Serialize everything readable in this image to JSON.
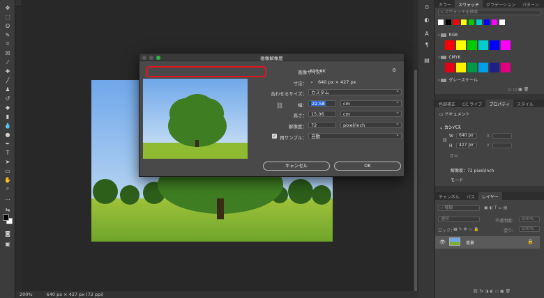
{
  "statusbar": {
    "zoom": "200%",
    "doc_info": "640 px × 427 px (72 ppi)"
  },
  "dialog": {
    "title": "画像解像度",
    "image_size_label": "画像サイズ：",
    "image_size_value": "800.6K",
    "dimensions_label": "寸法：",
    "dimensions_value": "640 px × 427 px",
    "fit_to_label": "合わせるサイズ：",
    "fit_to_value": "カスタム",
    "width_label": "幅：",
    "width_value": "22.58",
    "width_unit": "cm",
    "height_label": "高さ：",
    "height_value": "15.06",
    "height_unit": "cm",
    "resolution_label": "解像度：",
    "resolution_value": "72",
    "resolution_unit": "pixel/inch",
    "resample_label": "再サンプル：",
    "resample_value": "自動",
    "cancel_label": "キャンセル",
    "ok_label": "OK",
    "accent_highlight": "#e2151f"
  },
  "swatches_panel": {
    "tabs": [
      "カラー",
      "スウォッチ",
      "グラデーション",
      "パターン"
    ],
    "search_placeholder": "スウォッチを検索",
    "groups": [
      {
        "name": "RGB",
        "colors": [
          "#ff0000",
          "#ffff00",
          "#00cc00",
          "#00cccc",
          "#0000ff",
          "#ff00ff"
        ]
      },
      {
        "name": "CMYK",
        "colors": [
          "#e60012",
          "#fff100",
          "#009944",
          "#00a0e9",
          "#1d2088",
          "#e4007f"
        ]
      },
      {
        "name": "グレースケール",
        "colors": []
      }
    ],
    "top_colors": [
      "#ffffff",
      "#000000",
      "#ff0000",
      "#ffff00",
      "#00cc00",
      "#00cccc",
      "#0000ff",
      "#ff00ff",
      "#ffffff"
    ]
  },
  "properties_panel": {
    "tabs": [
      "色調補正",
      "CC ライブ",
      "プロパティ",
      "スタイル"
    ],
    "doc_label": "ドキュメント",
    "section": "カンバス",
    "w_label": "W",
    "w_value": "640 px",
    "h_label": "H",
    "h_value": "427 px",
    "x_label": "X",
    "y_label": "Y",
    "resolution_text": "解像度：72 pixel/inch",
    "mode_label": "モード"
  },
  "layers_panel": {
    "tabs": [
      "チャンネル",
      "パス",
      "レイヤー"
    ],
    "kind_placeholder": "種類",
    "blend_mode": "通常",
    "opacity_label": "不透明度：",
    "opacity_value": "100%",
    "lock_label": "ロック：",
    "fill_label": "塗り：",
    "fill_value": "100%",
    "layer_name": "背景"
  }
}
